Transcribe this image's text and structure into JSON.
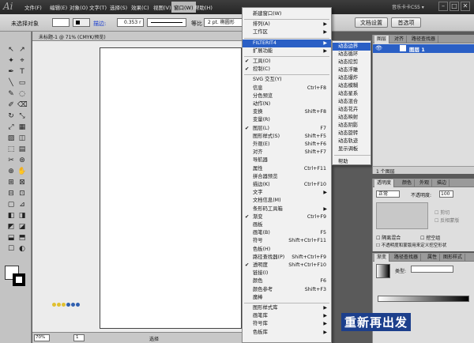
{
  "app": {
    "logo": "Ai"
  },
  "menubar": {
    "items": [
      "文件(F)",
      "编辑(E)",
      "对象(O)",
      "文字(T)",
      "选择(S)",
      "效果(C)",
      "视图(V)",
      "窗口(W)",
      "帮助(H)"
    ],
    "active_index": 7,
    "workspace": "音乐卡卡CS5 ▾"
  },
  "control_bar": {
    "selection": "未选择对象",
    "stroke_label": "描边:",
    "stroke_value": "0.353 r",
    "dash_label": "等比",
    "brush_label": "2 pt. 椭圆形",
    "doc_settings": "文档设置",
    "preferences": "首选项"
  },
  "document": {
    "tab_title": "未标题-1 @ 71% (CMYK/预览)",
    "zoom": "70%",
    "page": "1",
    "status": "选择"
  },
  "window_menu": {
    "items": [
      {
        "label": "新建窗口(W)",
        "shortcut": "",
        "checked": false,
        "arrow": false
      },
      {
        "label": "排列(A)",
        "shortcut": "",
        "checked": false,
        "arrow": true
      },
      {
        "label": "工作区",
        "shortcut": "",
        "checked": false,
        "arrow": true
      },
      {
        "label": "FILTERIT4",
        "shortcut": "",
        "checked": false,
        "arrow": true,
        "highlight": true
      },
      {
        "label": "扩展功能",
        "shortcut": "",
        "checked": false,
        "arrow": true
      },
      {
        "label": "工具(O)",
        "shortcut": "",
        "checked": true,
        "arrow": false
      },
      {
        "label": "控制(C)",
        "shortcut": "",
        "checked": true,
        "arrow": false
      },
      {
        "label": "SVG 交互(Y)",
        "shortcut": "",
        "checked": false,
        "arrow": false
      },
      {
        "label": "信息",
        "shortcut": "Ctrl+F8",
        "checked": false,
        "arrow": false
      },
      {
        "label": "分色预览",
        "shortcut": "",
        "checked": false,
        "arrow": false
      },
      {
        "label": "动作(N)",
        "shortcut": "",
        "checked": false,
        "arrow": false
      },
      {
        "label": "变换",
        "shortcut": "Shift+F8",
        "checked": false,
        "arrow": false
      },
      {
        "label": "变量(R)",
        "shortcut": "",
        "checked": false,
        "arrow": false
      },
      {
        "label": "图层(L)",
        "shortcut": "F7",
        "checked": true,
        "arrow": false
      },
      {
        "label": "图形样式(S)",
        "shortcut": "Shift+F5",
        "checked": false,
        "arrow": false
      },
      {
        "label": "外观(E)",
        "shortcut": "Shift+F6",
        "checked": false,
        "arrow": false
      },
      {
        "label": "对齐",
        "shortcut": "Shift+F7",
        "checked": false,
        "arrow": false
      },
      {
        "label": "导航器",
        "shortcut": "",
        "checked": false,
        "arrow": false
      },
      {
        "label": "属性",
        "shortcut": "Ctrl+F11",
        "checked": false,
        "arrow": false
      },
      {
        "label": "拼合器预览",
        "shortcut": "",
        "checked": false,
        "arrow": false
      },
      {
        "label": "描边(K)",
        "shortcut": "Ctrl+F10",
        "checked": false,
        "arrow": false
      },
      {
        "label": "文字",
        "shortcut": "",
        "checked": false,
        "arrow": true
      },
      {
        "label": "文档信息(M)",
        "shortcut": "",
        "checked": false,
        "arrow": false
      },
      {
        "label": "条形码工具箱",
        "shortcut": "",
        "checked": false,
        "arrow": true
      },
      {
        "label": "渐变",
        "shortcut": "Ctrl+F9",
        "checked": true,
        "arrow": false
      },
      {
        "label": "画板",
        "shortcut": "",
        "checked": false,
        "arrow": false
      },
      {
        "label": "画笔(B)",
        "shortcut": "F5",
        "checked": false,
        "arrow": false
      },
      {
        "label": "符号",
        "shortcut": "Shift+Ctrl+F11",
        "checked": false,
        "arrow": false
      },
      {
        "label": "色板(H)",
        "shortcut": "",
        "checked": false,
        "arrow": false
      },
      {
        "label": "路径查找器(P)",
        "shortcut": "Shift+Ctrl+F9",
        "checked": false,
        "arrow": false
      },
      {
        "label": "透明度",
        "shortcut": "Shift+Ctrl+F10",
        "checked": true,
        "arrow": false
      },
      {
        "label": "链接(I)",
        "shortcut": "",
        "checked": false,
        "arrow": false
      },
      {
        "label": "颜色",
        "shortcut": "F6",
        "checked": false,
        "arrow": false
      },
      {
        "label": "颜色参考",
        "shortcut": "Shift+F3",
        "checked": false,
        "arrow": false
      },
      {
        "label": "魔棒",
        "shortcut": "",
        "checked": false,
        "arrow": false
      },
      {
        "label": "图形样式库",
        "shortcut": "",
        "checked": false,
        "arrow": true
      },
      {
        "label": "画笔库",
        "shortcut": "",
        "checked": false,
        "arrow": true
      },
      {
        "label": "符号库",
        "shortcut": "",
        "checked": false,
        "arrow": true
      },
      {
        "label": "色板库",
        "shortcut": "",
        "checked": false,
        "arrow": true
      }
    ]
  },
  "submenu": {
    "items": [
      "动态边界",
      "动态循环",
      "动态挖剪",
      "动态浮雕",
      "动态爆炸",
      "动态模糊",
      "动态星系",
      "动态混合",
      "动态花卉",
      "动态映射",
      "动态阴影",
      "动态旋转",
      "动态轨迹",
      "显示调板",
      "帮助"
    ],
    "highlight_index": 0
  },
  "layers_panel": {
    "tabs": [
      "图层",
      "对齐",
      "路径查找器"
    ],
    "layer_name": "图层 1",
    "footer": "1 个图层"
  },
  "transparency_panel": {
    "tabs": [
      "透明度",
      "颜色",
      "外观",
      "描边"
    ],
    "blend_mode": "正常",
    "opacity_label": "不透明度:",
    "opacity": "100",
    "clip": "剪切",
    "invert_mask": "反相蒙版",
    "isolate": "隔离混合",
    "knockout": "挖空组",
    "opacity_mask": "不透明度和蒙版用来定义挖空形状"
  },
  "gradient_panel": {
    "tabs": [
      "渐变",
      "路径查找器",
      "属性",
      "图形样式"
    ],
    "type_label": "类型:"
  },
  "watermark": "重新再出发"
}
